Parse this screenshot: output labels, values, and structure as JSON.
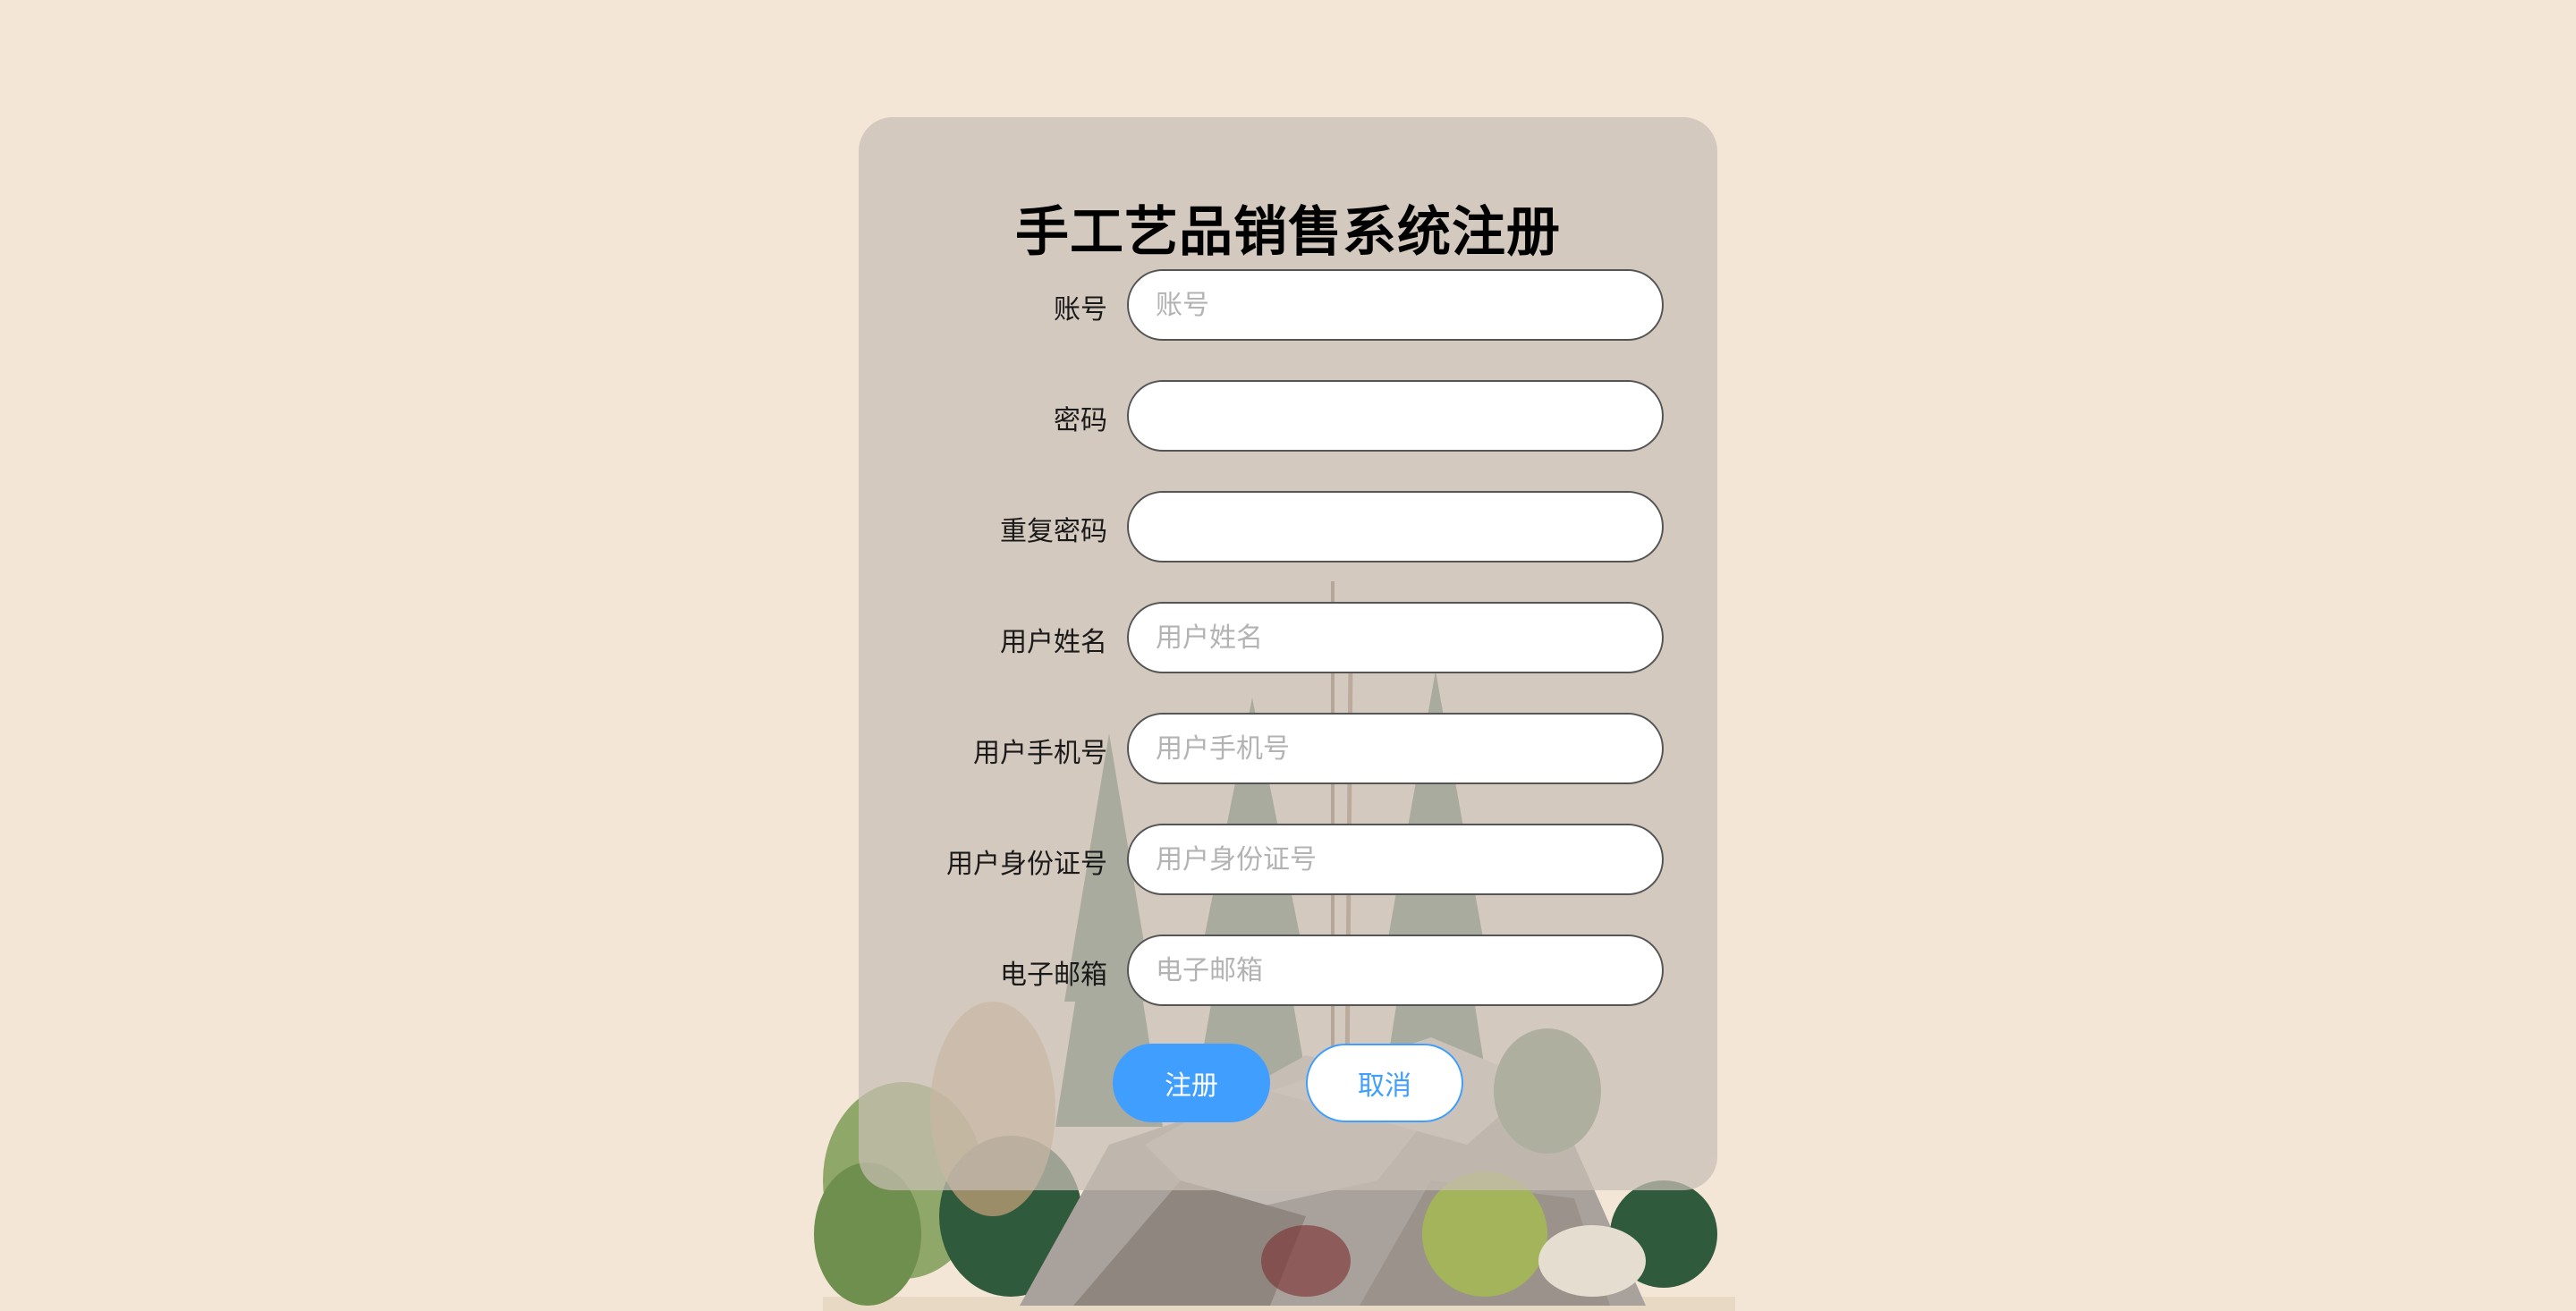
{
  "form": {
    "title": "手工艺品销售系统注册",
    "fields": [
      {
        "label": "账号",
        "placeholder": "账号",
        "type": "text"
      },
      {
        "label": "密码",
        "placeholder": "",
        "type": "password"
      },
      {
        "label": "重复密码",
        "placeholder": "",
        "type": "password"
      },
      {
        "label": "用户姓名",
        "placeholder": "用户姓名",
        "type": "text"
      },
      {
        "label": "用户手机号",
        "placeholder": "用户手机号",
        "type": "text"
      },
      {
        "label": "用户身份证号",
        "placeholder": "用户身份证号",
        "type": "text"
      },
      {
        "label": "电子邮箱",
        "placeholder": "电子邮箱",
        "type": "text"
      }
    ],
    "register_label": "注册",
    "cancel_label": "取消"
  },
  "colors": {
    "background": "#f4e6d7",
    "card": "#d5c9c0",
    "primary": "#409eff"
  }
}
